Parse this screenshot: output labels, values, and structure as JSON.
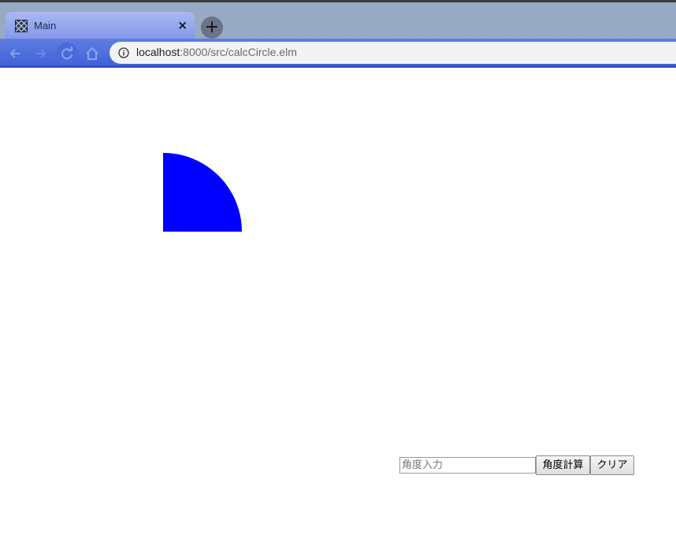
{
  "browser": {
    "tab_title": "Main",
    "tab_close": "×",
    "new_tab": "+",
    "url_host": "localhost",
    "url_path": ":8000/src/calcCircle.elm",
    "icons": {
      "tab_favicon": "elm-favicon-icon",
      "back": "arrow-left-icon",
      "forward": "arrow-right-icon",
      "reload": "reload-icon",
      "home": "home-icon",
      "info": "info-icon"
    }
  },
  "page": {
    "sector": {
      "angle_degrees": 90,
      "color": "#0000ff"
    },
    "angle_input": {
      "value": "",
      "placeholder": "角度入力"
    },
    "calc_button": "角度計算",
    "clear_button": "クリア"
  }
}
